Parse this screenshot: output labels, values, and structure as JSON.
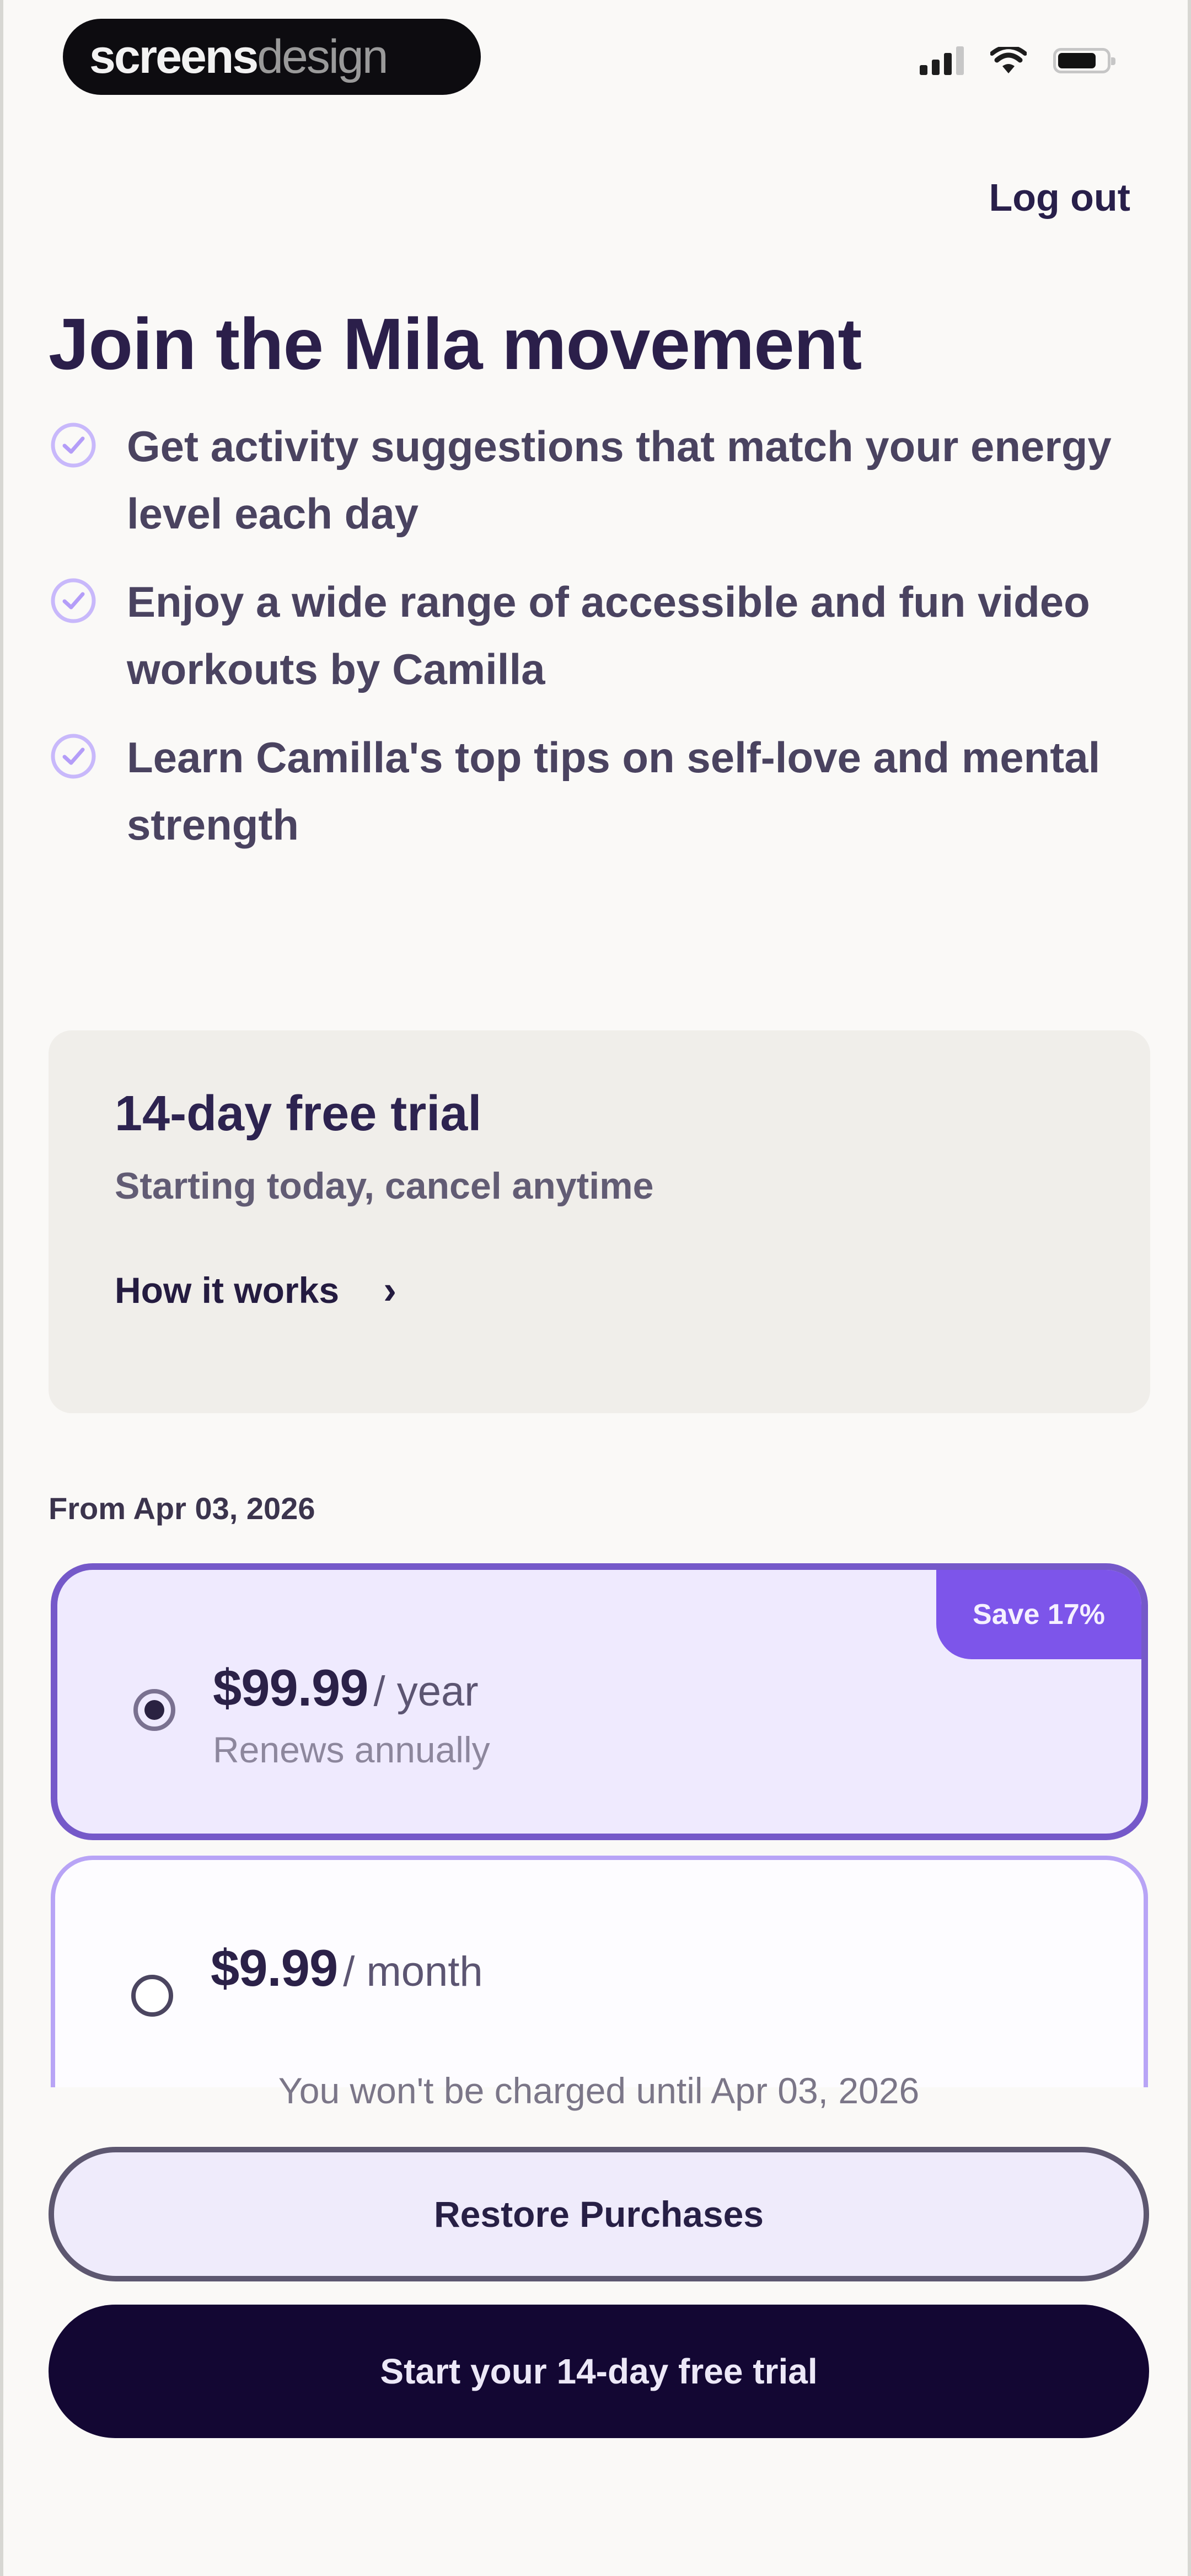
{
  "status_bar": {
    "brand_bold": "screens",
    "brand_light": "design",
    "icons": [
      "signal-icon",
      "wifi-icon",
      "battery-icon"
    ]
  },
  "header": {
    "logout_label": "Log out",
    "title": "Join the Mila movement"
  },
  "benefits": [
    {
      "icon": "check-circle-icon",
      "text": "Get activity suggestions that match your energy level each day"
    },
    {
      "icon": "check-circle-icon",
      "text": "Enjoy a wide range of accessible and fun video workouts by Camilla"
    },
    {
      "icon": "check-circle-icon",
      "text": "Learn Camilla's top tips on self-love and mental strength"
    }
  ],
  "trial_card": {
    "title": "14-day free trial",
    "subtitle": "Starting today, cancel anytime",
    "link_label": "How it works",
    "link_icon": "chevron-right-icon"
  },
  "from_date": "From Apr 03, 2026",
  "plans": [
    {
      "price": "$99.99",
      "period": "/ year",
      "renewal": "Renews annually",
      "badge": "Save 17%",
      "selected": true
    },
    {
      "price": "$9.99",
      "period": "/ month",
      "selected": false
    }
  ],
  "footer": {
    "charge_note": "You won't be charged until Apr 03, 2026",
    "restore_label": "Restore Purchases",
    "cta_label": "Start your 14-day free trial"
  },
  "colors": {
    "accent": "#7d55ea",
    "selected_border": "#7559c9",
    "primary_button": "#130733",
    "card_background": "#f0eeea"
  }
}
